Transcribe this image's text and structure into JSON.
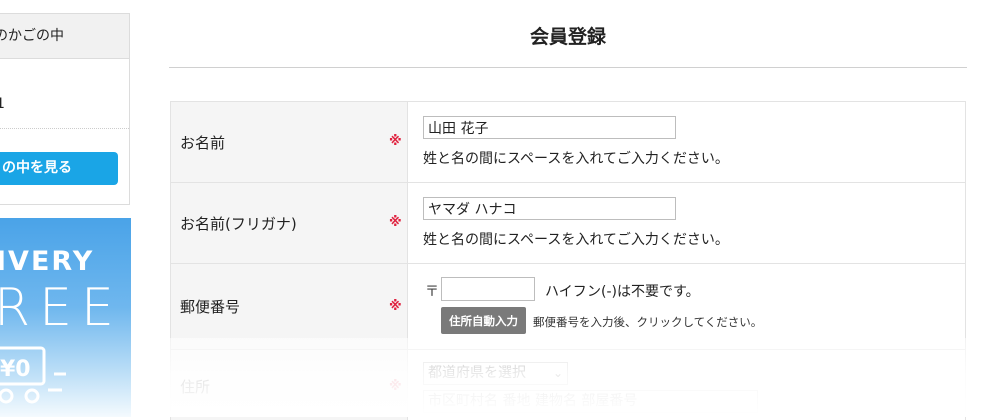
{
  "sidebar": {
    "cart_title": "のかごの中",
    "cart_count": "1",
    "cart_button": "の中を見る",
    "banner_line1": "IVERY",
    "banner_line2": "REE",
    "banner_price": "¥0"
  },
  "page": {
    "title": "会員登録"
  },
  "form": {
    "required_mark": "※",
    "name": {
      "label": "お名前",
      "value": "山田 花子",
      "hint": "姓と名の間にスペースを入れてご入力ください。"
    },
    "kana": {
      "label": "お名前(フリガナ)",
      "value": "ヤマダ ハナコ",
      "hint": "姓と名の間にスペースを入れてご入力ください。"
    },
    "postal": {
      "label": "郵便番号",
      "mark": "〒",
      "value": "",
      "note": "ハイフン(-)は不要です。",
      "auto_button": "住所自動入力",
      "auto_note": "郵便番号を入力後、クリックしてください。"
    },
    "address": {
      "label": "住所",
      "prefecture_placeholder": "都道府県を選択",
      "city_placeholder": "市区町村名 番地 建物名 部屋番号"
    }
  },
  "colors": {
    "accent": "#1aa5e6",
    "required": "#e0223f",
    "button_gray": "#7a7a7a"
  }
}
